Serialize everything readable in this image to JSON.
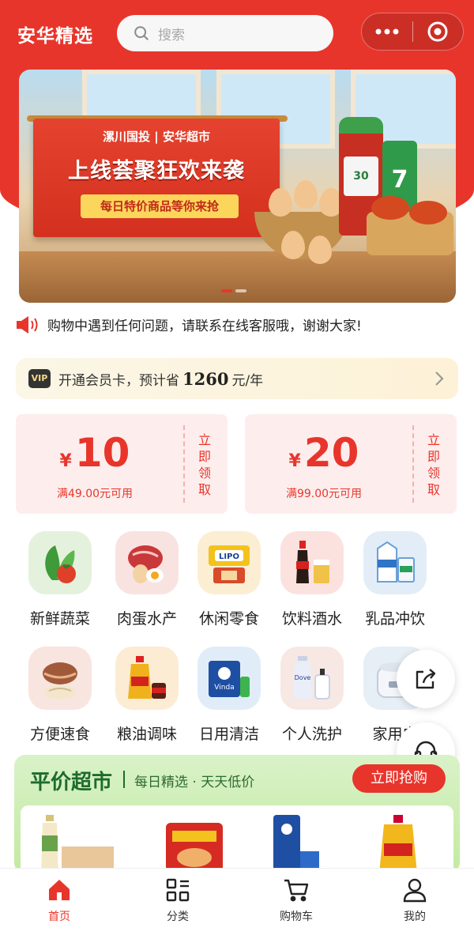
{
  "app": {
    "title": "安华精选"
  },
  "search": {
    "placeholder": "搜索",
    "icon": "search-icon"
  },
  "capsule": {
    "more_icon": "more-dots-icon",
    "close_icon": "target-close-icon"
  },
  "banner": {
    "brand": "漯川国投 | 安华超市",
    "headline": "上线荟聚狂欢来袭",
    "subline": "每日特价商品等你来抢",
    "bottle_label": "30",
    "can_label": "7",
    "slide_count": 2,
    "active_slide": 1
  },
  "notice": {
    "icon": "speaker-icon",
    "text": "购物中遇到任何问题，请联系在线客服哦，谢谢大家!"
  },
  "vip": {
    "badge": "VIP",
    "prefix": "开通会员卡，预计省",
    "amount": "1260",
    "suffix": "元/年"
  },
  "coupons": [
    {
      "currency": "¥",
      "value": "10",
      "condition": "满49.00元可用",
      "action": "立即领取"
    },
    {
      "currency": "¥",
      "value": "20",
      "condition": "满99.00元可用",
      "action": "立即领取"
    }
  ],
  "categories": [
    {
      "label": "新鲜蔬菜",
      "icon": "vegetables-icon"
    },
    {
      "label": "肉蛋水产",
      "icon": "meat-eggs-icon"
    },
    {
      "label": "休闲零食",
      "icon": "snacks-icon"
    },
    {
      "label": "饮料酒水",
      "icon": "drinks-icon"
    },
    {
      "label": "乳品冲饮",
      "icon": "dairy-icon"
    },
    {
      "label": "方便速食",
      "icon": "instant-food-icon"
    },
    {
      "label": "粮油调味",
      "icon": "oil-seasoning-icon"
    },
    {
      "label": "日用清洁",
      "icon": "cleaning-icon"
    },
    {
      "label": "个人洗护",
      "icon": "personal-care-icon"
    },
    {
      "label": "家用电",
      "icon": "appliance-icon"
    }
  ],
  "floating": {
    "share_icon": "share-icon",
    "service_icon": "headset-icon"
  },
  "market": {
    "title": "平价超市",
    "subtitle": "每日精选 · 天天低价",
    "button": "立即抢购"
  },
  "tabbar": [
    {
      "label": "首页",
      "icon": "home-icon",
      "active": true
    },
    {
      "label": "分类",
      "icon": "category-icon",
      "active": false
    },
    {
      "label": "购物车",
      "icon": "cart-icon",
      "active": false
    },
    {
      "label": "我的",
      "icon": "profile-icon",
      "active": false
    }
  ],
  "colors": {
    "primary": "#e8352b",
    "market_green": "#1e6b2e",
    "vip_bg": "#fbf6e6"
  }
}
